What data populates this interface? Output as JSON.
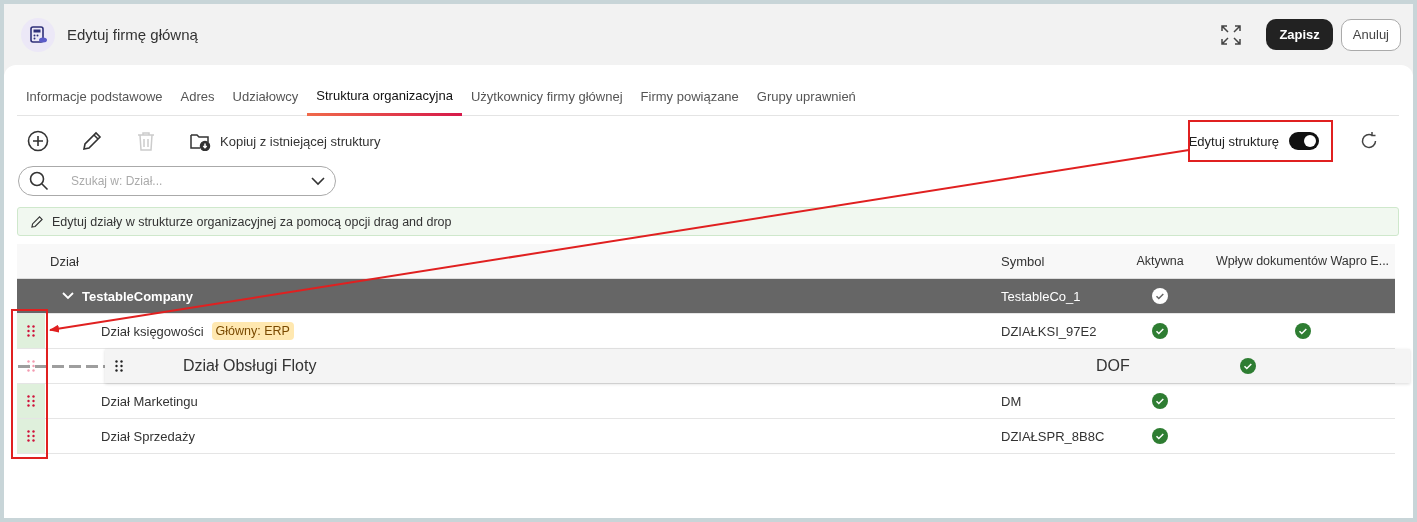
{
  "header": {
    "title": "Edytuj firmę główną",
    "save_button": "Zapisz",
    "cancel_button": "Anuluj"
  },
  "tabs": [
    {
      "label": "Informacje podstawowe",
      "selected": false
    },
    {
      "label": "Adres",
      "selected": false
    },
    {
      "label": "Udziałowcy",
      "selected": false
    },
    {
      "label": "Struktura organizacyjna",
      "selected": true
    },
    {
      "label": "Użytkownicy firmy głównej",
      "selected": false
    },
    {
      "label": "Firmy powiązane",
      "selected": false
    },
    {
      "label": "Grupy uprawnień",
      "selected": false
    }
  ],
  "toolbar": {
    "actions": [
      {
        "kind": "add",
        "disabled": false
      },
      {
        "kind": "edit",
        "disabled": false
      },
      {
        "kind": "delete",
        "disabled": true
      }
    ],
    "copy_button": "Kopiuj z istniejącej struktury",
    "toggle": {
      "label": "Edytuj strukturę",
      "on": true
    }
  },
  "search": {
    "placeholder": "Szukaj w: Dział..."
  },
  "info_bar": "Edytuj działy w strukturze organizacyjnej za pomocą opcji drag and drop",
  "table": {
    "columns": [
      "Dział",
      "Symbol",
      "Aktywna",
      "Wpływ dokumentów Wapro E..."
    ],
    "rows": [
      {
        "name": "TestableCompany",
        "symbol": "TestableCo_1",
        "active": true,
        "expanded": true,
        "children": [
          {
            "name": "Dział księgowości",
            "badge": "Główny: ERP",
            "symbol": "DZIAŁKSI_97E2",
            "active": true,
            "document_flow": true,
            "dragged": false
          },
          {
            "dragged": true
          },
          {
            "name": "Dział Marketingu",
            "symbol": "DM",
            "active": true,
            "document_flow": false,
            "dragged": false
          },
          {
            "name": "Dział Sprzedaży",
            "symbol": "DZIAŁSPR_8B8C",
            "active": true,
            "document_flow": false,
            "dragged": false
          }
        ]
      }
    ]
  },
  "drag_preview": {
    "name": "Dział Obsługi Floty",
    "symbol": "DOF",
    "active": true
  }
}
